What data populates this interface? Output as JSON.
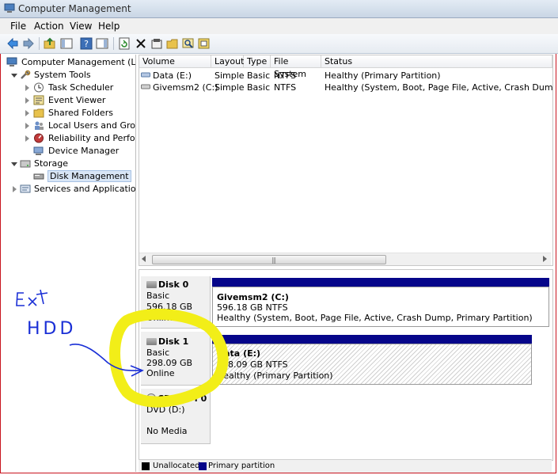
{
  "window": {
    "title": "Computer Management"
  },
  "menu": [
    "File",
    "Action",
    "View",
    "Help"
  ],
  "tree": {
    "root": "Computer Management (Local",
    "system_tools": "System Tools",
    "task_scheduler": "Task Scheduler",
    "event_viewer": "Event Viewer",
    "shared_folders": "Shared Folders",
    "local_users": "Local Users and Groups",
    "reliability": "Reliability and Performa",
    "device_manager": "Device Manager",
    "storage": "Storage",
    "disk_management": "Disk Management",
    "services": "Services and Applications"
  },
  "volumes": {
    "columns": [
      "Volume",
      "Layout",
      "Type",
      "File System",
      "Status"
    ],
    "rows": [
      {
        "volume": "Data (E:)",
        "layout": "Simple",
        "type": "Basic",
        "fs": "NTFS",
        "status": "Healthy (Primary Partition)"
      },
      {
        "volume": "Givemsm2 (C:)",
        "layout": "Simple",
        "type": "Basic",
        "fs": "NTFS",
        "status": "Healthy (System, Boot, Page File, Active, Crash Dump, Primary"
      }
    ]
  },
  "disks": {
    "disk0": {
      "name": "Disk 0",
      "type": "Basic",
      "size": "596.18 GB",
      "state": "Online",
      "partition": {
        "name": "Givemsm2  (C:)",
        "size": "596.18 GB NTFS",
        "status": "Healthy (System, Boot, Page File, Active, Crash Dump, Primary Partition)"
      }
    },
    "disk1": {
      "name": "Disk 1",
      "type": "Basic",
      "size": "298.09 GB",
      "state": "Online",
      "partition": {
        "name": "Data  (E:)",
        "size": "298.09 GB NTFS",
        "status": "Healthy (Primary Partition)"
      }
    },
    "cdrom": {
      "name": "CD-ROM 0",
      "drive": "DVD (D:)",
      "media": "No Media"
    }
  },
  "legend": {
    "unallocated": "Unallocated",
    "primary": "Primary partition",
    "unallocated_color": "#000000",
    "primary_color": "#06068a"
  },
  "annotation": {
    "text_line1": "Ext",
    "text_line2": "HDD",
    "ink_color": "#1a2fd6",
    "highlight_color": "#f2ee18"
  }
}
